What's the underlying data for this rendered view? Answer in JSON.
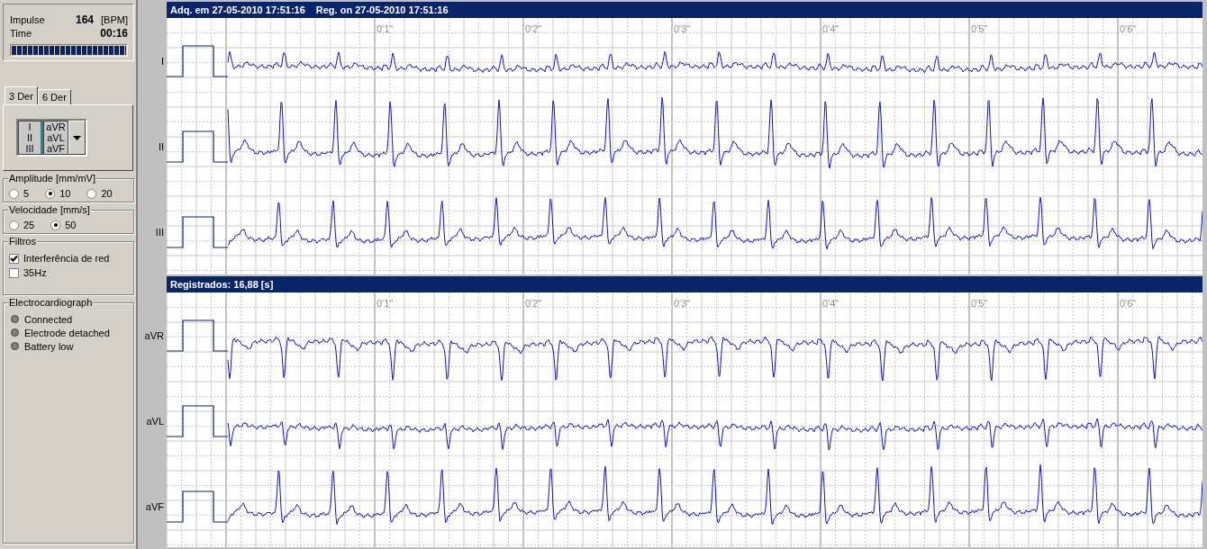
{
  "status": {
    "impulse_label": "Impulse",
    "impulse_value": "164",
    "impulse_unit": "[BPM]",
    "time_label": "Time",
    "time_value": "00:16",
    "progress": {
      "level": 1
    }
  },
  "tabs": [
    {
      "label": "3 Der",
      "selected": true
    },
    {
      "label": "6 Der",
      "selected": false
    }
  ],
  "lead_groups": [
    {
      "leads": [
        "I",
        "II",
        "III"
      ],
      "selected": true
    },
    {
      "leads": [
        "aVR",
        "aVL",
        "aVF"
      ],
      "selected": false
    }
  ],
  "amplitude": {
    "title": "Amplitude [mm/mV]",
    "options": [
      {
        "label": "5",
        "selected": false
      },
      {
        "label": "10",
        "selected": true
      },
      {
        "label": "20",
        "selected": false
      }
    ]
  },
  "velocidade": {
    "title": "Velocidade [mm/s]",
    "options": [
      {
        "label": "25",
        "selected": false
      },
      {
        "label": "50",
        "selected": true
      }
    ]
  },
  "filtros": {
    "title": "Filtros",
    "items": [
      {
        "label": "Interferência de red",
        "checked": true
      },
      {
        "label": "35Hz",
        "checked": false
      }
    ]
  },
  "electrocardiograph": {
    "title": "Electrocardiograph",
    "indicators": [
      {
        "label": "Connected",
        "on": false
      },
      {
        "label": "Electrode detached",
        "on": false
      },
      {
        "label": "Battery low",
        "on": false
      }
    ]
  },
  "panels": [
    {
      "header": [
        "Adq. em 27-05-2010 17:51:16",
        "Reg. on 27-05-2010 17:51:16"
      ],
      "time_marks": [
        "0'1\"",
        "0'2\"",
        "0'3\"",
        "0'4\"",
        "0'5\"",
        "0'6\""
      ],
      "leads": [
        "I",
        "II",
        "III"
      ]
    },
    {
      "header": [
        "Registrados: 16,88 [s]"
      ],
      "time_marks": [
        "0'1\"",
        "0'2\"",
        "0'3\"",
        "0'4\"",
        "0'5\"",
        "0'6\""
      ],
      "leads": [
        "aVR",
        "aVL",
        "aVF"
      ]
    }
  ]
}
